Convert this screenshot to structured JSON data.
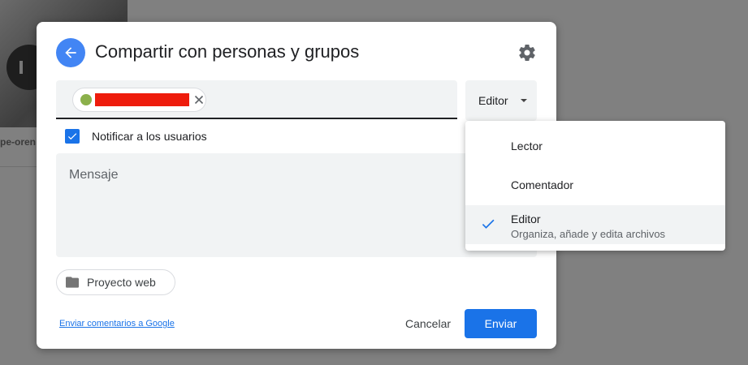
{
  "background": {
    "caption": "pe-oren"
  },
  "dialog": {
    "title": "Compartir con personas y grupos",
    "role_button_label": "Editor",
    "notify_label": "Notificar a los usuarios",
    "notify_checked": true,
    "message_placeholder": "Mensaje",
    "folder_label": "Proyecto web",
    "feedback_link": "Enviar comentarios a Google",
    "cancel_label": "Cancelar",
    "send_label": "Enviar"
  },
  "role_menu": {
    "items": [
      {
        "label": "Lector",
        "description": "",
        "selected": false
      },
      {
        "label": "Comentador",
        "description": "",
        "selected": false
      },
      {
        "label": "Editor",
        "description": "Organiza, añade y edita archivos",
        "selected": true
      }
    ]
  },
  "colors": {
    "accent": "#1a73e8",
    "back_button": "#4285f4",
    "avatar": "#8bb04b",
    "redaction": "#ee1c0c",
    "overlay": "#808080"
  },
  "icons": [
    "arrow-back-icon",
    "gear-icon",
    "close-icon",
    "folder-icon",
    "check-icon",
    "caret-down-icon"
  ]
}
